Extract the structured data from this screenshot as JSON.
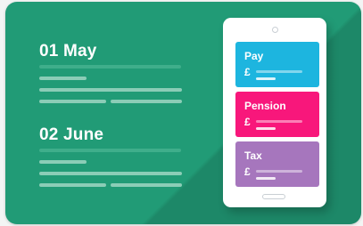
{
  "timeline": {
    "entries": [
      {
        "date": "01 May"
      },
      {
        "date": "02 June"
      }
    ]
  },
  "phone": {
    "tiles": [
      {
        "label": "Pay",
        "currency": "£",
        "color": "#1db5df"
      },
      {
        "label": "Pension",
        "currency": "£",
        "color": "#f8177b"
      },
      {
        "label": "Tax",
        "currency": "£",
        "color": "#a676bd"
      }
    ]
  },
  "colors": {
    "background": "#219b76",
    "placeholder_line": "#55b898"
  }
}
